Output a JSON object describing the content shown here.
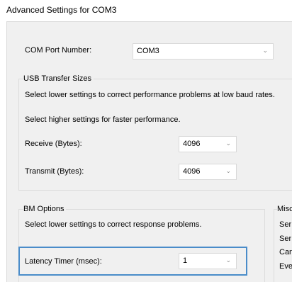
{
  "window": {
    "title": "Advanced Settings for COM3"
  },
  "com_port": {
    "label": "COM Port Number:",
    "value": "COM3"
  },
  "usb_transfer": {
    "group_title": "USB Transfer Sizes",
    "hint_lower": "Select lower settings to correct performance problems at low baud rates.",
    "hint_higher": "Select higher settings for faster performance.",
    "receive_label": "Receive (Bytes):",
    "receive_value": "4096",
    "transmit_label": "Transmit (Bytes):",
    "transmit_value": "4096"
  },
  "bm_options": {
    "group_title": "BM Options",
    "hint": "Select lower settings to correct response problems.",
    "latency_label": "Latency Timer (msec):",
    "latency_value": "1"
  },
  "misc_options": {
    "group_title": "Misc",
    "items": [
      "Ser",
      "Ser",
      "Can",
      "Eve"
    ]
  },
  "icons": {
    "dropdown": "chevron-down-icon"
  },
  "colors": {
    "panel_bg": "#f0f0f0",
    "focus_border": "#4a8cc9",
    "field_border": "#d9d9d9",
    "group_border": "#dcdcdc"
  }
}
